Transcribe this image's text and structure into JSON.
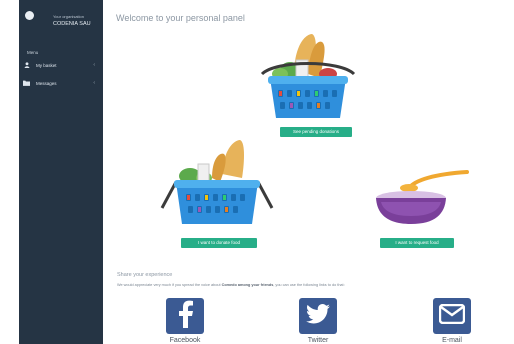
{
  "sidebar": {
    "org_label": "Your organisation",
    "org_name": "CODENIA SAU",
    "section_title": "Menu",
    "items": [
      {
        "label": "My basket",
        "icon": "person-icon"
      },
      {
        "label": "Messages",
        "icon": "folder-icon"
      }
    ]
  },
  "main": {
    "title": "Welcome to your personal panel",
    "buttons": {
      "pending_donations": "See pending donations",
      "donate": "I want to donate food",
      "request": "I want to request food"
    },
    "share": {
      "title": "Share your experience",
      "text_pre": "We would appreciate very much if you spread the voice about ",
      "text_bold1": "Comedo among your friends",
      "text_mid": ", you can use the following links to do that:"
    },
    "social": [
      {
        "label": "Facebook",
        "icon": "facebook-icon"
      },
      {
        "label": "Twitter",
        "icon": "twitter-icon"
      },
      {
        "label": "E-mail",
        "icon": "email-icon"
      }
    ]
  },
  "colors": {
    "sidebar_bg": "#253444",
    "accent_green": "#27ae88",
    "basket_blue": "#2f8fdc",
    "social_blue": "#3b5a93",
    "bowl_purple": "#7a3f9a"
  }
}
